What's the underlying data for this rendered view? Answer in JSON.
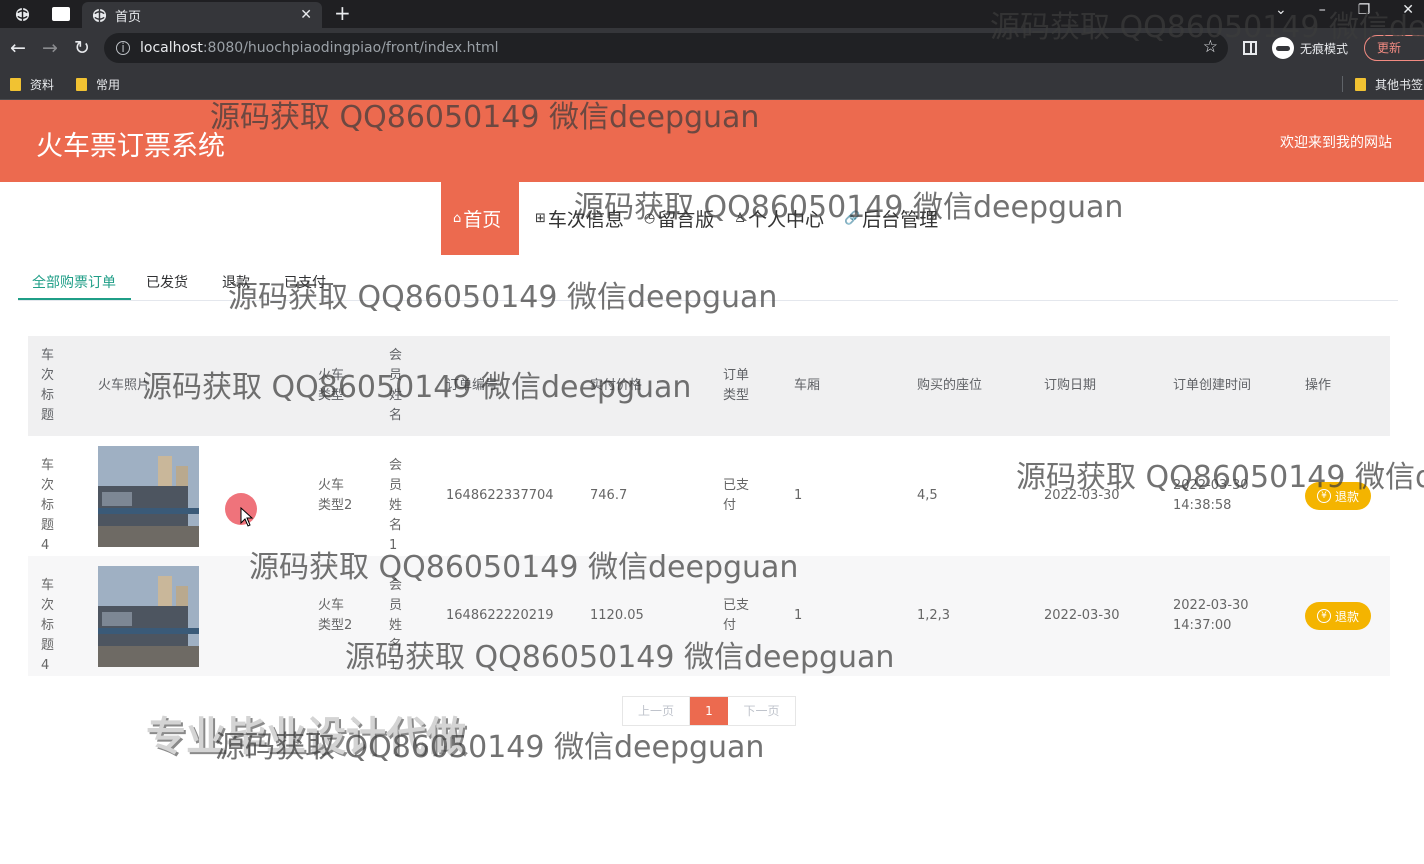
{
  "browser": {
    "tab_title": "首页",
    "url_host": "localhost",
    "url_rest": ":8080/huochpiaodingpiao/front/index.html",
    "incognito_label": "无痕模式",
    "update_label": "更新",
    "bookmarks": [
      "资料",
      "常用"
    ],
    "other_bookmarks": "其他书签"
  },
  "site": {
    "title": "火车票订票系统",
    "welcome": "欢迎来到我的网站"
  },
  "nav": {
    "items": [
      {
        "label": "首页",
        "icon": "home-icon"
      },
      {
        "label": "车次信息",
        "icon": "grid-icon"
      },
      {
        "label": "留言版",
        "icon": "clock-icon"
      },
      {
        "label": "个人中心",
        "icon": "user-icon"
      },
      {
        "label": "后台管理",
        "icon": "link-icon"
      }
    ]
  },
  "subtabs": [
    "全部购票订单",
    "已发货",
    "退款",
    "已支付"
  ],
  "table": {
    "headers": [
      "车次标题",
      "火车照片",
      "火车类型",
      "会员姓名",
      "订单编号",
      "实付价格",
      "订单类型",
      "车厢",
      "购买的座位",
      "订购日期",
      "订单创建时间",
      "操作"
    ],
    "rows": [
      {
        "title": "车次标题4",
        "type": "火车类型2",
        "member": "会员姓名1",
        "order_no": "1648622337704",
        "price": "746.7",
        "order_type": "已支付",
        "car": "1",
        "seats": "4,5",
        "date": "2022-03-30",
        "created_date": "2022-03-30",
        "created_time": "14:38:58",
        "action": "退款"
      },
      {
        "title": "车次标题4",
        "type": "火车类型2",
        "member": "会员姓名1",
        "order_no": "1648622220219",
        "price": "1120.05",
        "order_type": "已支付",
        "car": "1",
        "seats": "1,2,3",
        "date": "2022-03-30",
        "created_date": "2022-03-30",
        "created_time": "14:37:00",
        "action": "退款"
      }
    ]
  },
  "pagination": {
    "prev": "上一页",
    "current": "1",
    "next": "下一页"
  },
  "watermark": "源码获取 QQ86050149 微信deepguan",
  "promo": "专业毕业设计代做"
}
